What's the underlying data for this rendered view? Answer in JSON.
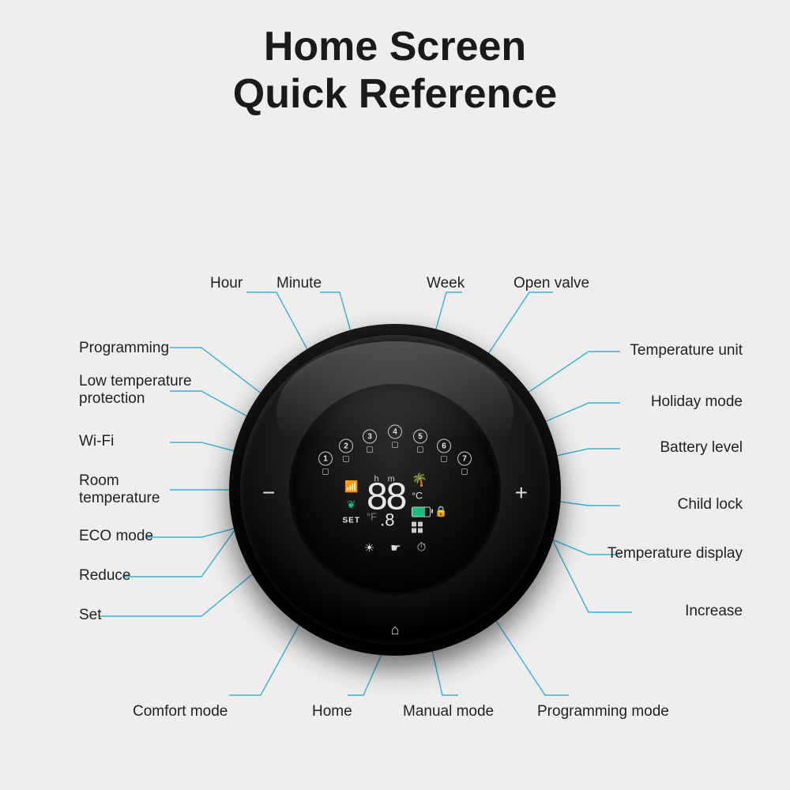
{
  "title": {
    "line1": "Home Screen",
    "line2": "Quick Reference"
  },
  "labels": {
    "hour": "Hour",
    "minute": "Minute",
    "week": "Week",
    "open_valve": "Open valve",
    "programming": "Programming",
    "low_temp": "Low temperature\nprotection",
    "wifi": "Wi-Fi",
    "room_temp": "Room\ntemperature",
    "eco": "ECO mode",
    "reduce": "Reduce",
    "set": "Set",
    "temp_unit": "Temperature unit",
    "holiday": "Holiday mode",
    "battery": "Battery level",
    "child_lock": "Child lock",
    "temp_display": "Temperature display",
    "increase": "Increase",
    "comfort": "Comfort  mode",
    "home": "Home",
    "manual": "Manual mode",
    "prog_mode": "Programming mode"
  },
  "display": {
    "periods": [
      "1",
      "2",
      "3",
      "4",
      "5",
      "6",
      "7"
    ],
    "hm_label": "h    m",
    "big": "88",
    "decimal": ".8",
    "unit_c": "°C",
    "unit_f": "°F",
    "set_label": "SET",
    "wifi_icon": "⏚",
    "leaf_icon": "✿",
    "palm_icon": "🌴",
    "lock_icon": "🔒",
    "sun_icon": "☀",
    "hand_icon": "☛",
    "clock_icon": "⏱",
    "minus": "−",
    "plus": "+",
    "home_icon": "⌂"
  }
}
